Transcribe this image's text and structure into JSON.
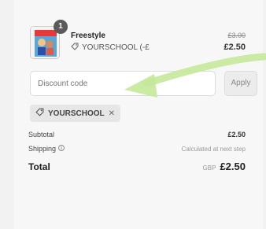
{
  "item": {
    "quantity": "1",
    "title": "Freestyle",
    "code": "YOURSCHOOL (-£",
    "old_price": "£3.00",
    "new_price": "£2.50"
  },
  "discount": {
    "placeholder": "Discount code",
    "apply_label": "Apply"
  },
  "applied_code": {
    "label": "YOURSCHOOL",
    "remove_symbol": "✕"
  },
  "summary": {
    "subtotal_label": "Subtotal",
    "subtotal_value": "£2.50",
    "shipping_label": "Shipping",
    "shipping_value": "Calculated at next step",
    "total_label": "Total",
    "currency": "GBP",
    "total_value": "£2.50"
  },
  "colors": {
    "annotation_arrow": "#c5e89a"
  }
}
